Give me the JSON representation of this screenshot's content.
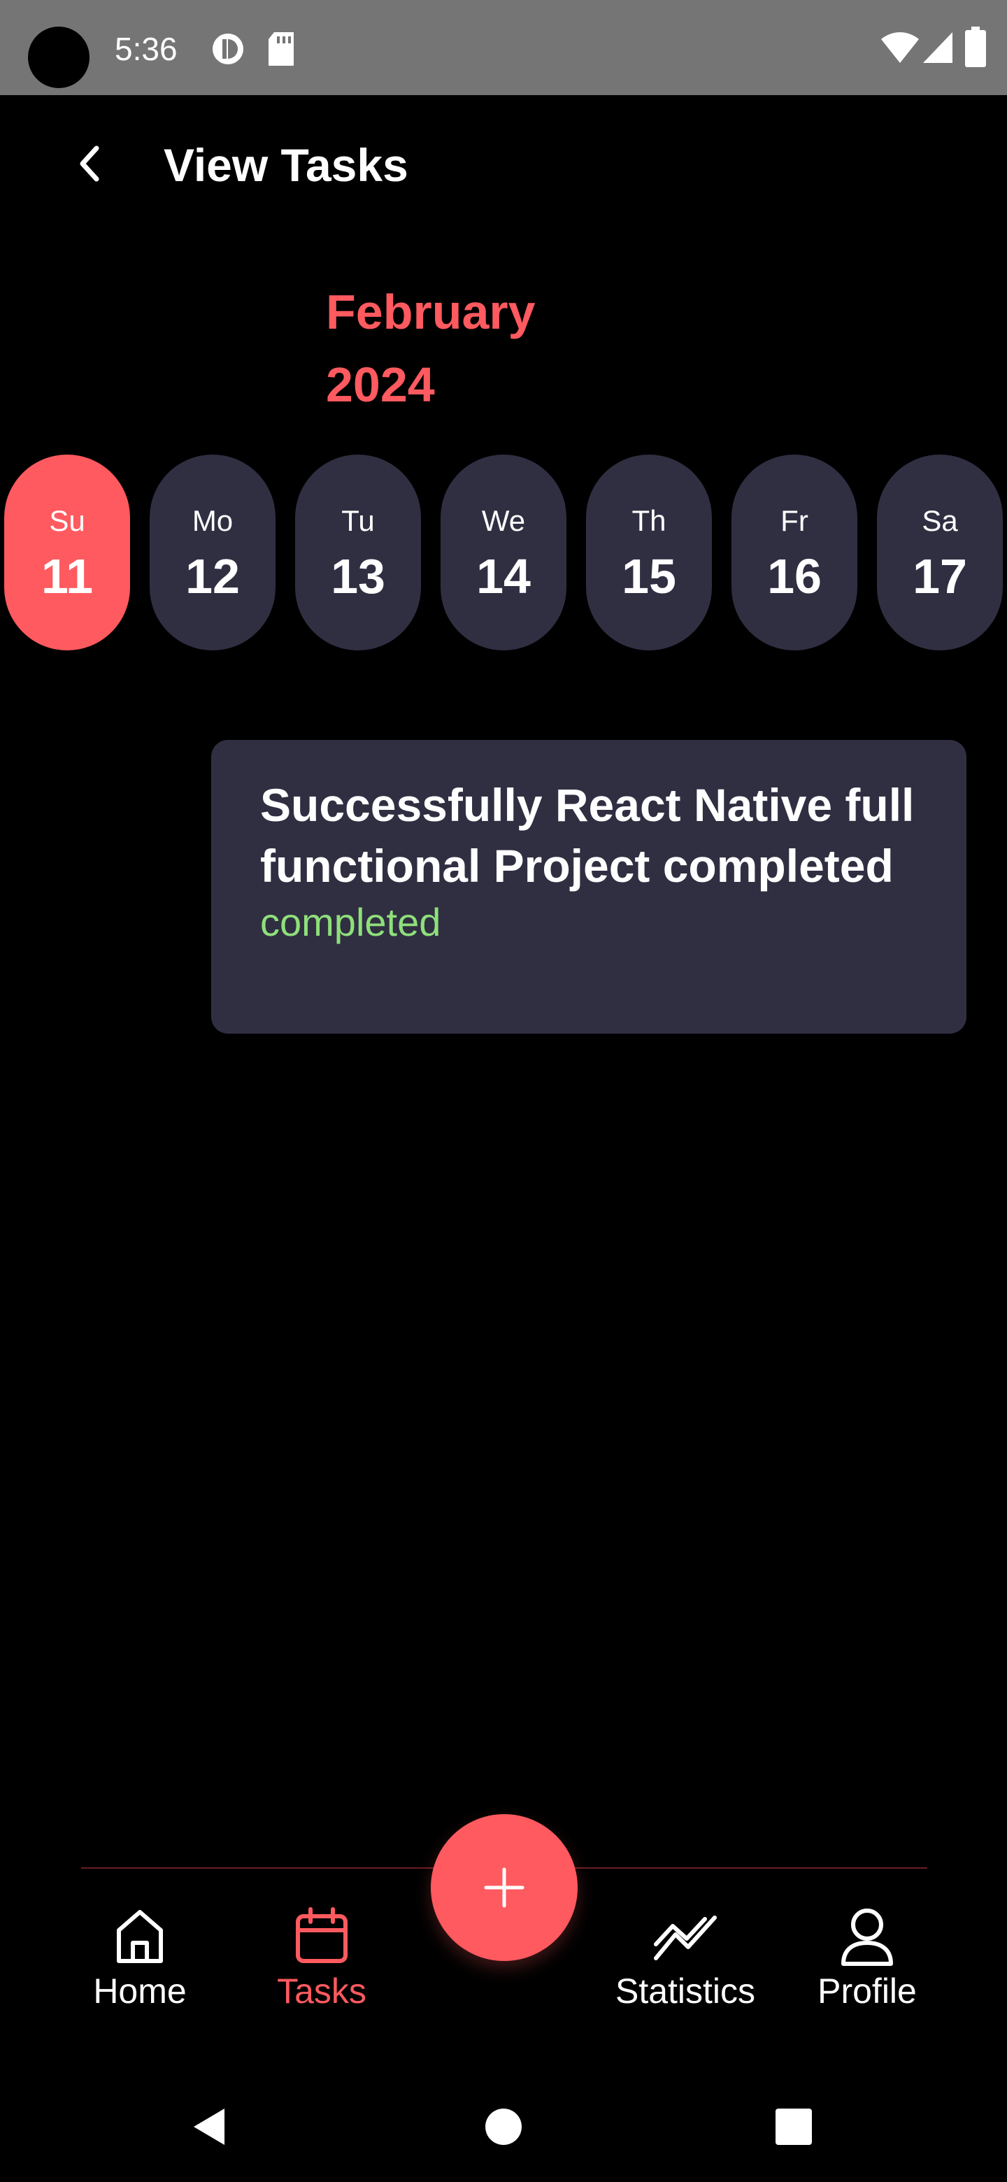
{
  "status_bar": {
    "time": "5:36"
  },
  "header": {
    "title": "View Tasks"
  },
  "calendar": {
    "month": "February",
    "year": "2024",
    "days": [
      {
        "name": "Su",
        "number": "11",
        "selected": true
      },
      {
        "name": "Mo",
        "number": "12",
        "selected": false
      },
      {
        "name": "Tu",
        "number": "13",
        "selected": false
      },
      {
        "name": "We",
        "number": "14",
        "selected": false
      },
      {
        "name": "Th",
        "number": "15",
        "selected": false
      },
      {
        "name": "Fr",
        "number": "16",
        "selected": false
      },
      {
        "name": "Sa",
        "number": "17",
        "selected": false
      }
    ]
  },
  "tasks": [
    {
      "title": "Successfully React Native full functional Project completed",
      "status": "completed"
    }
  ],
  "bottom_nav": {
    "items": [
      {
        "label": "Home",
        "icon": "home-icon",
        "active": false
      },
      {
        "label": "Tasks",
        "icon": "calendar-icon",
        "active": true
      },
      {
        "label": "Statistics",
        "icon": "statistics-icon",
        "active": false
      },
      {
        "label": "Profile",
        "icon": "profile-icon",
        "active": false
      }
    ],
    "fab_icon": "plus-icon"
  },
  "colors": {
    "accent": "#ff5a5f",
    "card": "#302f42",
    "background": "#000000",
    "status_completed": "#8ee07a",
    "status_bar": "#757575"
  }
}
